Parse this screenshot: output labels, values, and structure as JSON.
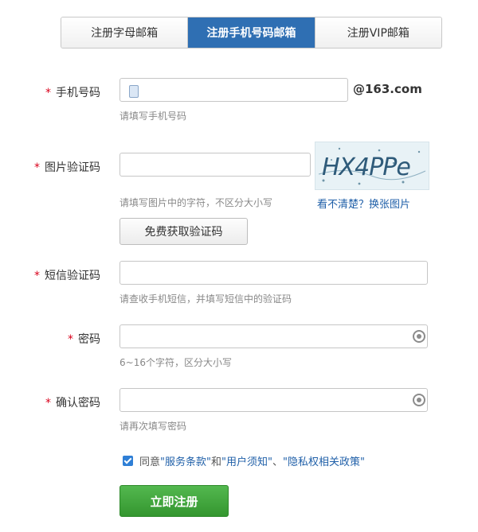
{
  "tabs": [
    {
      "label": "注册字母邮箱",
      "active": false
    },
    {
      "label": "注册手机号码邮箱",
      "active": true
    },
    {
      "label": "注册VIP邮箱",
      "active": false
    }
  ],
  "form": {
    "required_mark": "*",
    "phone": {
      "label": "手机号码",
      "value": "",
      "suffix": "@163.com",
      "hint": "请填写手机号码"
    },
    "captcha": {
      "label": "图片验证码",
      "value": "",
      "hint": "请填写图片中的字符，不区分大小写",
      "image_text": "HX4PPe",
      "refresh_link": "看不清楚？换张图片"
    },
    "get_code_button": "免费获取验证码",
    "sms_code": {
      "label": "短信验证码",
      "value": "",
      "hint": "请查收手机短信，并填写短信中的验证码"
    },
    "password": {
      "label": "密码",
      "value": "",
      "hint": "6~16个字符，区分大小写"
    },
    "confirm_password": {
      "label": "确认密码",
      "value": "",
      "hint": "请再次填写密码"
    }
  },
  "agreement": {
    "checked": true,
    "prefix": "同意",
    "terms": "\"服务条款\"",
    "and": "和",
    "notice": "\"用户须知\"",
    "separator": "、",
    "privacy": "\"隐私权相关政策\""
  },
  "submit_button": "立即注册",
  "colors": {
    "accent": "#2f6fb3",
    "link": "#1f5fa8",
    "required": "#d9001b",
    "submit": "#3fa63a"
  }
}
